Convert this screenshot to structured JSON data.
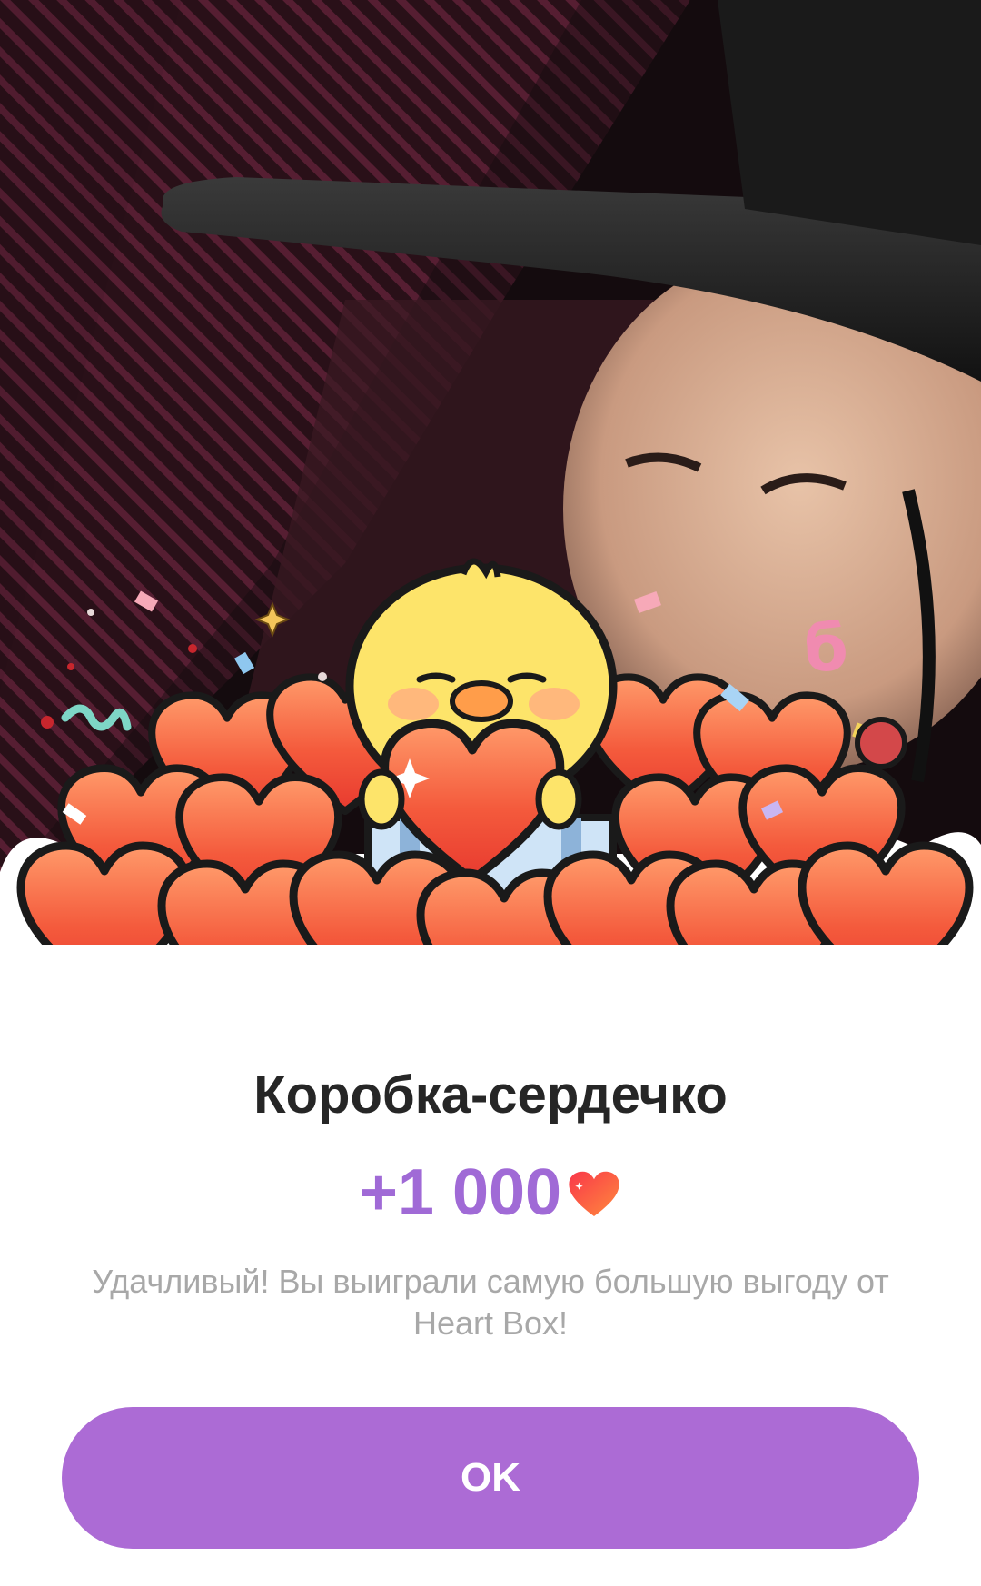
{
  "dialog": {
    "title": "Коробка-сердечко",
    "reward_amount": "+1 000",
    "reward_icon": "heart-icon",
    "message": "Удачливый! Вы выиграли самую большую выгоду от Heart Box!",
    "ok_label": "OK"
  },
  "illustration": {
    "subject": "chick-with-heart-box-icon",
    "confetti_glyph": "б"
  },
  "colors": {
    "accent": "#ac6bd5",
    "reward_text": "#a06ad6",
    "title_text": "#262626",
    "message_text": "#a8a8a8",
    "heart_fill": "#f45a3c"
  }
}
